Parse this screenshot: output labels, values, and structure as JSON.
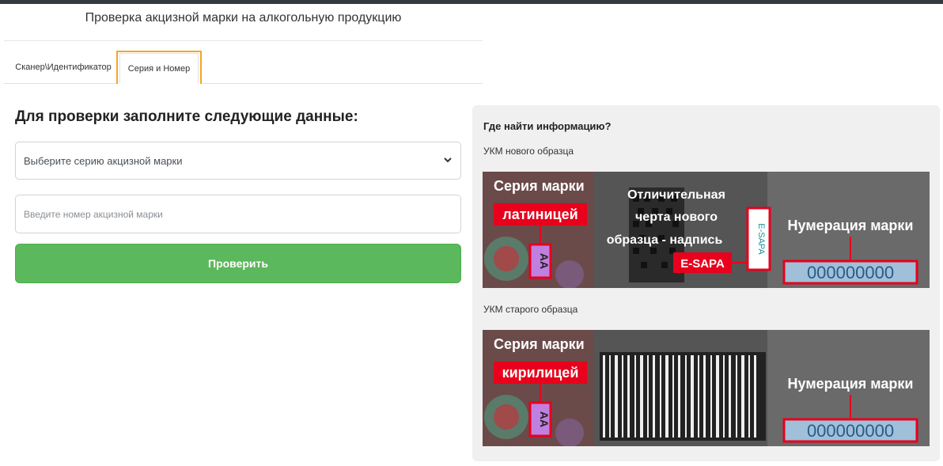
{
  "page": {
    "title": "Проверка акцизной марки на алкогольную продукцию"
  },
  "tabs": [
    {
      "label": "Сканер\\Идентификатор"
    },
    {
      "label": "Серия и Номер"
    }
  ],
  "form": {
    "heading": "Для проверки заполните следующие данные:",
    "series_select": {
      "value": "Выберите серию акцизной марки"
    },
    "number_input": {
      "placeholder": "Введите номер акцизной марки"
    },
    "submit_label": "Проверить"
  },
  "info": {
    "title": "Где найти информацию?",
    "new_stamp": {
      "caption": "УКМ нового образца",
      "series_label_1": "Серия марки",
      "series_label_2": "латиницей",
      "distinct_1": "Отличительная",
      "distinct_2": "черта нового",
      "distinct_3": "образца - надпись",
      "esapa": "E-SAPA",
      "vertical_text": "E-SAPA",
      "numbering_label": "Нумерация марки",
      "series_value": "AA",
      "number_value": "000000000"
    },
    "old_stamp": {
      "caption": "УКМ старого образца",
      "series_label_1": "Серия марки",
      "series_label_2": "кирилицей",
      "numbering_label": "Нумерация марки",
      "series_value": "AA",
      "number_value": "000000000"
    }
  },
  "colors": {
    "accent_green": "#5cb85c",
    "tab_highlight": "#f5a623",
    "label_red": "#e8001c",
    "topbar": "#343a40"
  },
  "icons": {
    "select_arrow": "chevron-down-icon"
  }
}
